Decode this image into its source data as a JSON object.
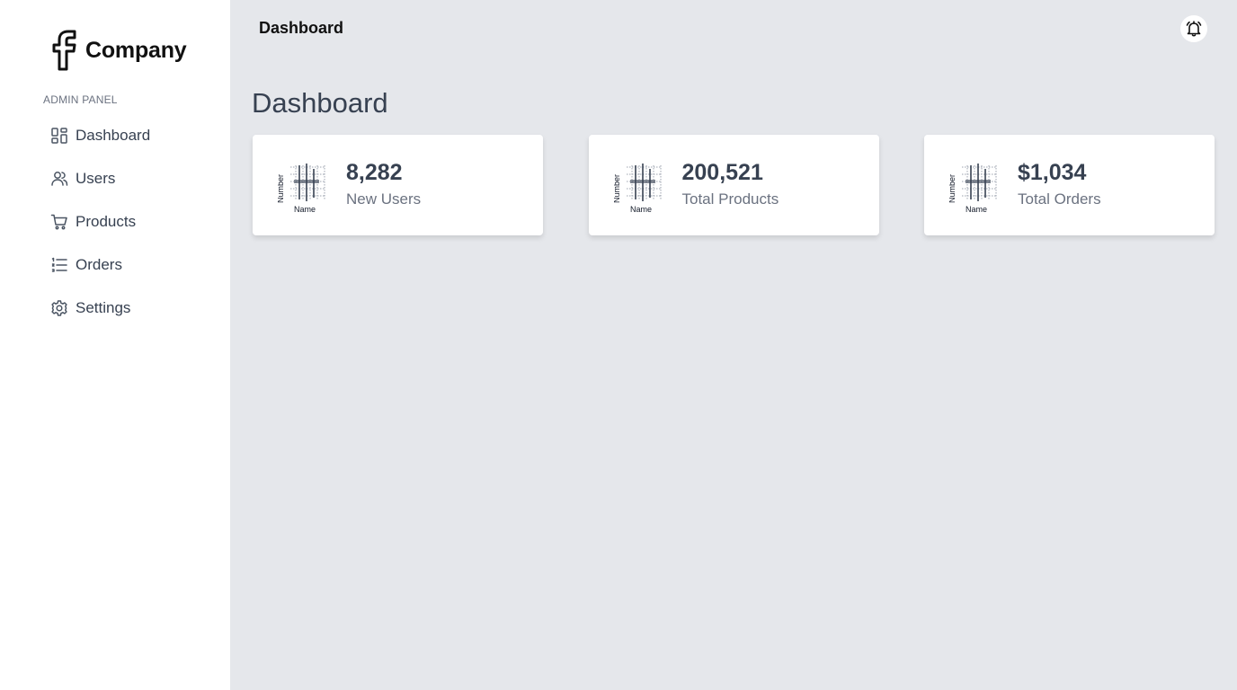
{
  "brand": {
    "name": "Company",
    "logo_icon": "facebook-f-icon"
  },
  "sidebar": {
    "section_label": "ADMIN PANEL",
    "items": [
      {
        "label": "Dashboard",
        "icon": "grid-icon"
      },
      {
        "label": "Users",
        "icon": "users-icon"
      },
      {
        "label": "Products",
        "icon": "cart-icon"
      },
      {
        "label": "Orders",
        "icon": "list-icon"
      },
      {
        "label": "Settings",
        "icon": "gear-icon"
      }
    ]
  },
  "header": {
    "title": "Dashboard",
    "notification_icon": "bell-icon"
  },
  "main": {
    "title": "Dashboard",
    "cards": [
      {
        "value": "8,282",
        "label": "New Users"
      },
      {
        "value": "200,521",
        "label": "Total Products"
      },
      {
        "value": "$1,034",
        "label": "Total Orders"
      }
    ]
  },
  "mini_chart": {
    "ylabel": "Number",
    "xlabel": "Name"
  }
}
